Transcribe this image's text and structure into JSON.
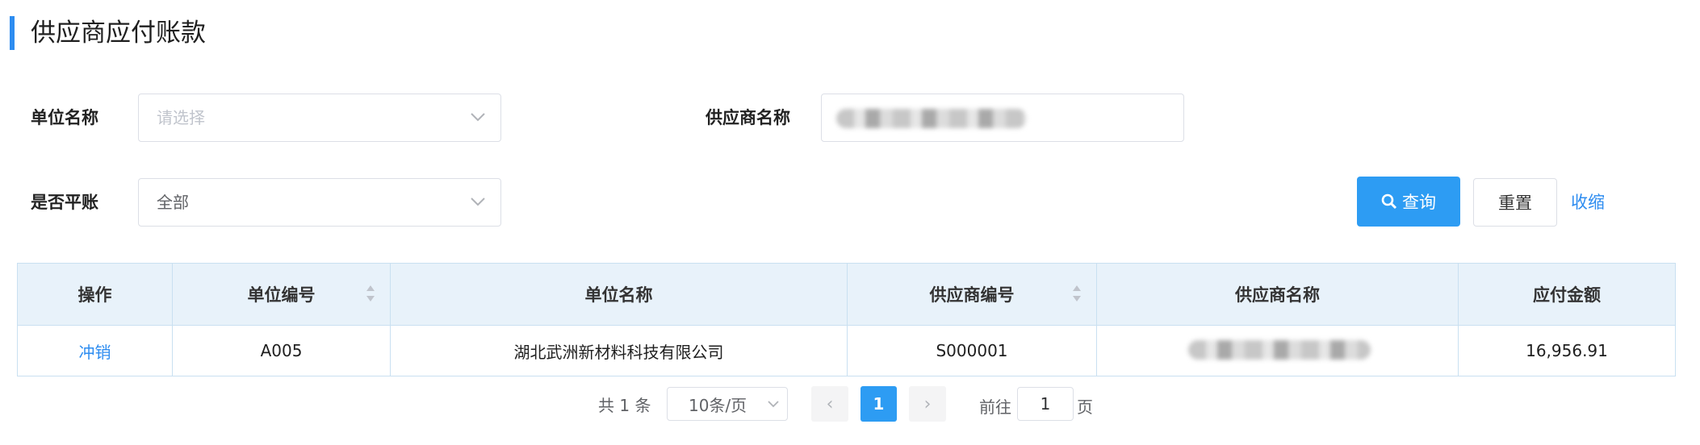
{
  "page": {
    "title": "供应商应付账款"
  },
  "filters": {
    "unit_name_label": "单位名称",
    "unit_name_placeholder": "请选择",
    "supplier_name_label": "供应商名称",
    "settled_label": "是否平账",
    "settled_value": "全部"
  },
  "actions": {
    "query": "查询",
    "reset": "重置",
    "collapse": "收缩"
  },
  "table": {
    "headers": [
      "操作",
      "单位编号",
      "单位名称",
      "供应商编号",
      "供应商名称",
      "应付金额"
    ],
    "rows": [
      {
        "action": "冲销",
        "unit_code": "A005",
        "unit_name": "湖北武洲新材料科技有限公司",
        "supplier_code": "S000001",
        "amount": "16,956.91"
      }
    ]
  },
  "pagination": {
    "total": "共 1 条",
    "page_size": "10条/页",
    "current_page": "1",
    "goto_prefix": "前往",
    "goto_value": "1",
    "goto_suffix": "页"
  },
  "colors": {
    "accent": "#2d8cf0",
    "primary_button": "#2d9cf3",
    "header_bg": "#e8f2fa"
  }
}
